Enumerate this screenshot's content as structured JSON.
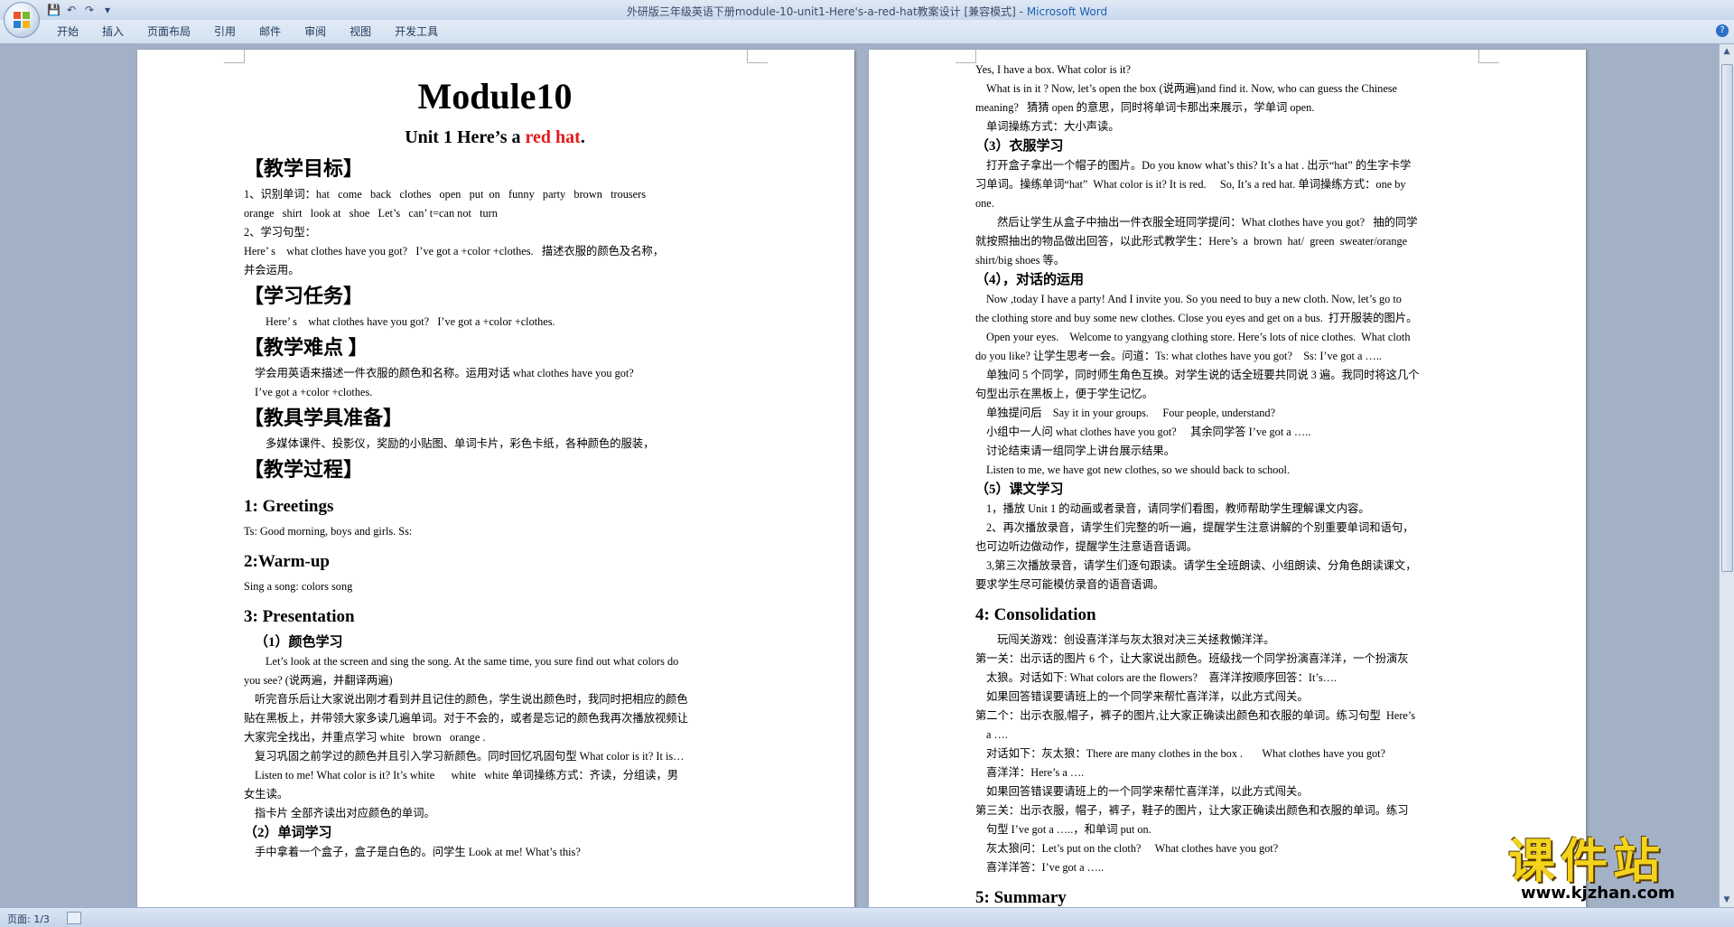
{
  "window": {
    "title": "外研版三年级英语下册module-10-unit1-Here's-a-red-hat教案设计 [兼容模式] - ",
    "app_name": "Microsoft Word"
  },
  "ribbon": {
    "tabs": [
      "开始",
      "插入",
      "页面布局",
      "引用",
      "邮件",
      "审阅",
      "视图",
      "开发工具"
    ]
  },
  "status": {
    "page": "页面: 1/3"
  },
  "watermark": {
    "main": "课件站",
    "url": "www.kjzhan.com"
  },
  "page1": {
    "title": "Module10",
    "unit": [
      "Unit 1    Here’s  a  ",
      "red",
      "  hat",
      "."
    ],
    "lines": [
      {
        "c": "h-sec",
        "t": "【教学目标】"
      },
      {
        "c": "p just",
        "t": "1、识别单词：hat   come   back   clothes   open   put  on   funny   party   brown   trousers"
      },
      {
        "c": "p",
        "t": "orange   shirt   look at   shoe   Let’s   can’ t=can not   turn"
      },
      {
        "c": "p",
        "t": "2、学习句型："
      },
      {
        "c": "p",
        "t": "Here’ s    what clothes have you got?   I’ve got a +color +clothes.   描述衣服的颜色及名称，"
      },
      {
        "c": "p",
        "t": "并会运用。"
      },
      {
        "c": "h-sec",
        "t": "【学习任务】"
      },
      {
        "c": "p ind",
        "t": "Here’ s    what clothes have you got?   I’ve got a +color +clothes."
      },
      {
        "c": "h-sec",
        "t": "【教学难点 】"
      },
      {
        "c": "p ind1",
        "t": "学会用英语来描述一件衣服的颜色和名称。运用对话 what clothes have you got?"
      },
      {
        "c": "p ind1",
        "t": "I’ve got a +color +clothes."
      },
      {
        "c": "h-sec",
        "t": "【教具学具准备】"
      },
      {
        "c": "p ind",
        "t": "多媒体课件、投影仪，奖励的小贴图、单词卡片，彩色卡纸，各种颜色的服装，"
      },
      {
        "c": "h-sec",
        "t": "【教学过程】"
      },
      {
        "c": "h-num",
        "t": "1: Greetings"
      },
      {
        "c": "p",
        "t": "Ts: Good morning, boys and girls. Ss:"
      },
      {
        "c": "h-num",
        "t": "2:Warm-up"
      },
      {
        "c": "p",
        "t": "Sing a song: colors song"
      },
      {
        "c": "h-num",
        "t": "3: Presentation"
      },
      {
        "c": "h-sub ind1",
        "t": "（1）颜色学习"
      },
      {
        "c": "p ind",
        "t": "Let’s look at the screen and sing the song. At the same time, you sure find out what colors do"
      },
      {
        "c": "p",
        "t": "you see? (说两遍，并翻译两遍)"
      },
      {
        "c": "p ind1",
        "t": "听完音乐后让大家说出刚才看到并且记住的颜色，学生说出颜色时，我同时把相应的颜色"
      },
      {
        "c": "p",
        "t": "贴在黑板上，并带领大家多读几遍单词。对于不会的，或者是忘记的颜色我再次播放视频让"
      },
      {
        "c": "p",
        "t": "大家完全找出，并重点学习 white   brown   orange ."
      },
      {
        "c": "p ind1",
        "t": "复习巩固之前学过的颜色并且引入学习新颜色。同时回忆巩固句型 What color is it? It is…"
      },
      {
        "c": "p ind1",
        "t": "Listen to me! What color is it? It’s white      white   white 单词操练方式：齐读，分组读，男"
      },
      {
        "c": "p",
        "t": "女生读。"
      },
      {
        "c": "p ind1",
        "t": "指卡片 全部齐读出对应颜色的单词。"
      },
      {
        "c": "h-sub",
        "t": "（2）单词学习"
      },
      {
        "c": "p ind1",
        "t": "手中拿着一个盒子，盒子是白色的。问学生 Look at me! What’s this?"
      }
    ]
  },
  "page2": {
    "lines": [
      {
        "c": "p",
        "t": "Yes, I have a box. What color is it?"
      },
      {
        "c": "p ind1 just",
        "t": "What is in it ? Now, let’s open the box (说两遍)and find it. Now, who can guess the Chinese"
      },
      {
        "c": "p",
        "t": "meaning?   猜猜 open 的意思，同时将单词卡那出来展示，学单词 open."
      },
      {
        "c": "p ind1",
        "t": "单词操练方式：大小声读。"
      },
      {
        "c": "h-sub",
        "t": "（3）衣服学习"
      },
      {
        "c": "p ind1",
        "t": "打开盒子拿出一个帽子的图片。Do you know what’s this? It’s a hat . 出示“hat” 的生字卡学"
      },
      {
        "c": "p",
        "t": "习单词。操练单词“hat”  What color is it? It is red.     So, It’s a red hat. 单词操练方式：one by"
      },
      {
        "c": "p",
        "t": "one."
      },
      {
        "c": "p ind",
        "t": "然后让学生从盒子中抽出一件衣服全班同学提问：What clothes have you got?   抽的同学"
      },
      {
        "c": "p",
        "t": "就按照抽出的物品做出回答，以此形式教学生：Here’s  a  brown  hat/  green  sweater/orange"
      },
      {
        "c": "p",
        "t": "shirt/big shoes 等。"
      },
      {
        "c": "h-sub",
        "t": "（4），对话的运用"
      },
      {
        "c": "p ind1",
        "t": "Now ,today I have a party! And I invite you. So you need to buy a new cloth. Now, let’s go to"
      },
      {
        "c": "p",
        "t": "the clothing store and buy some new clothes. Close you eyes and get on a bus.  打开服装的图片。"
      },
      {
        "c": "p ind1",
        "t": "Open your eyes.    Welcome to yangyang clothing store. Here’s lots of nice clothes.  What cloth"
      },
      {
        "c": "p",
        "t": "do you like? 让学生思考一会。问道：Ts: what clothes have you got?    Ss: I’ve got a ….."
      },
      {
        "c": "p ind1",
        "t": "单独问 5 个同学，同时师生角色互换。对学生说的话全班要共同说 3 遍。我同时将这几个"
      },
      {
        "c": "p",
        "t": "句型出示在黑板上，便于学生记忆。"
      },
      {
        "c": "p ind1",
        "t": "单独提问后    Say it in your groups.     Four people, understand?"
      },
      {
        "c": "p ind1",
        "t": "小组中一人问 what clothes have you got?     其余同学答 I’ve got a ….."
      },
      {
        "c": "p ind1",
        "t": "讨论结束请一组同学上讲台展示结果。"
      },
      {
        "c": "p ind1",
        "t": "Listen to me, we have got new clothes, so we should back to school."
      },
      {
        "c": "h-sub",
        "t": "（5）课文学习"
      },
      {
        "c": "p ind1",
        "t": "1，播放 Unit 1 的动画或者录音，请同学们看图，教师帮助学生理解课文内容。"
      },
      {
        "c": "p ind1",
        "t": "2、再次播放录音，请学生们完整的听一遍，提醒学生注意讲解的个别重要单词和语句，"
      },
      {
        "c": "p",
        "t": "也可边听边做动作，提醒学生注意语音语调。"
      },
      {
        "c": "p ind1",
        "t": "3,第三次播放录音，请学生们逐句跟读。请学生全班朗读、小组朗读、分角色朗读课文，"
      },
      {
        "c": "p",
        "t": "要求学生尽可能模仿录音的语音语调。"
      },
      {
        "c": "h-num",
        "t": "4: Consolidation"
      },
      {
        "c": "p ind",
        "t": "玩闯关游戏：创设喜洋洋与灰太狼对决三关拯救懒洋洋。"
      },
      {
        "c": "p",
        "t": "第一关：出示话的图片 6 个，让大家说出颜色。班级找一个同学扮演喜洋洋，一个扮演灰"
      },
      {
        "c": "p ind1",
        "t": "太狼。对话如下: What colors are the flowers?    喜洋洋按顺序回答：It’s…."
      },
      {
        "c": "p ind1",
        "t": "如果回答错误要请班上的一个同学来帮忙喜洋洋，以此方式闯关。"
      },
      {
        "c": "p",
        "t": "第二个：出示衣服,帽子，裤子的图片,让大家正确读出颜色和衣服的单词。练习句型  Here’s"
      },
      {
        "c": "p ind1",
        "t": "a …."
      },
      {
        "c": "p ind1",
        "t": "对话如下：灰太狼：There are many clothes in the box .       What clothes have you got?"
      },
      {
        "c": "p ind1",
        "t": "喜洋洋：Here’s a …."
      },
      {
        "c": "p ind1",
        "t": "如果回答错误要请班上的一个同学来帮忙喜洋洋，以此方式闯关。"
      },
      {
        "c": "p",
        "t": "第三关：出示衣服，帽子，裤子，鞋子的图片，让大家正确读出颜色和衣服的单词。练习"
      },
      {
        "c": "p ind1",
        "t": "句型 I’ve got a …..，和单词 put on."
      },
      {
        "c": "p ind1",
        "t": "灰太狼问：Let’s put on the cloth?     What clothes have you got?"
      },
      {
        "c": "p ind1",
        "t": "喜洋洋答：I’ve got a ….."
      },
      {
        "c": "h-num",
        "t": "5: Summary"
      }
    ]
  }
}
